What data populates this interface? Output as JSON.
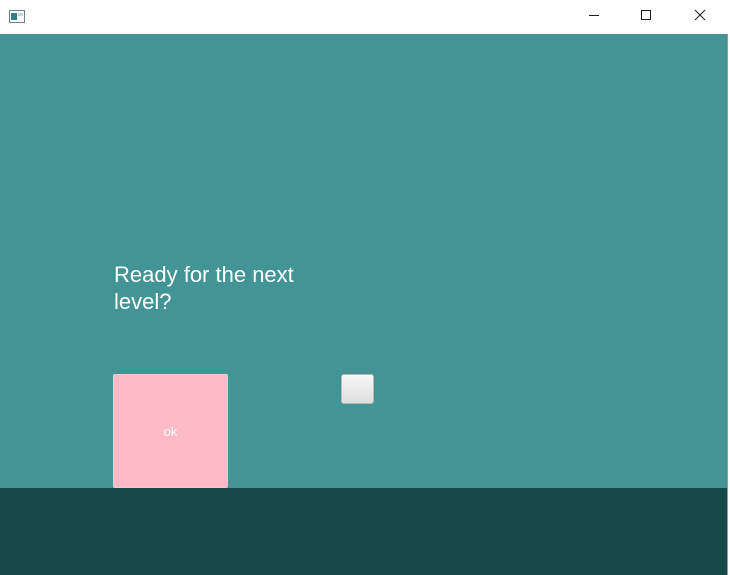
{
  "window": {
    "title": "",
    "controls": {
      "minimize_icon": "minimize-icon",
      "maximize_icon": "maximize-icon",
      "close_icon": "close-icon"
    }
  },
  "scene": {
    "prompt": "Ready for the next level?",
    "ok_button_label": "ok",
    "blank_button_label": ""
  },
  "colors": {
    "background": "#429594",
    "footer": "#17484a",
    "ok_button": "#ffbac6",
    "text": "#ffffff"
  }
}
